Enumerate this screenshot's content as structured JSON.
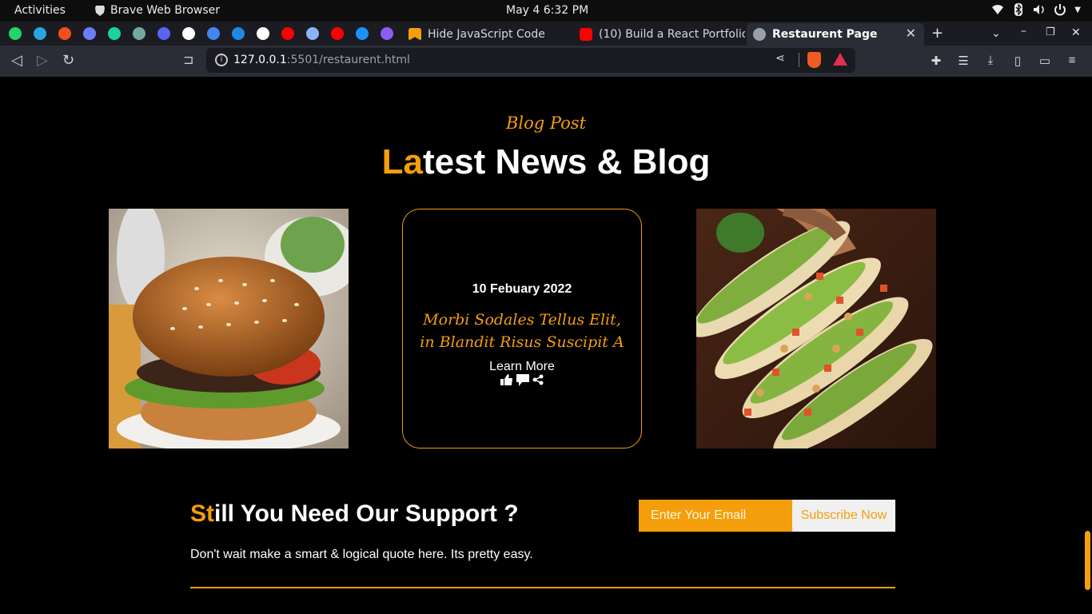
{
  "system": {
    "activities": "Activities",
    "app_name": "Brave Web Browser",
    "clock": "May 4   6:32 PM"
  },
  "tabs": [
    {
      "label": "Hide JavaScript Code",
      "favicon_color": "#f59e0b"
    },
    {
      "label": "(10) Build a React Portfolio",
      "favicon_color": "#ff0000"
    },
    {
      "label": "Restaurent Page",
      "favicon_color": "#9aa0a6"
    }
  ],
  "pinned_tabs": [
    {
      "icon": "whatsapp-icon",
      "color": "#25d366"
    },
    {
      "icon": "telegram-icon",
      "color": "#2aa3df"
    },
    {
      "icon": "figma-icon",
      "color": "#f24e1e"
    },
    {
      "icon": "app-icon",
      "color": "#6c7cff"
    },
    {
      "icon": "app-icon",
      "color": "#1cd1a1"
    },
    {
      "icon": "openai-icon",
      "color": "#74aa9c"
    },
    {
      "icon": "app-icon",
      "color": "#5865f2"
    },
    {
      "icon": "app-icon",
      "color": "#ffffff"
    },
    {
      "icon": "docs-icon",
      "color": "#4285f4"
    },
    {
      "icon": "play-icon",
      "color": "#1e88e5"
    },
    {
      "icon": "app-icon",
      "color": "#ffffff"
    },
    {
      "icon": "youtube-icon",
      "color": "#ff0000"
    },
    {
      "icon": "send-icon",
      "color": "#8ab4f8"
    },
    {
      "icon": "youtube-icon",
      "color": "#ff0000"
    },
    {
      "icon": "app-icon",
      "color": "#1e90ff"
    },
    {
      "icon": "app-icon",
      "color": "#8b5cf6"
    }
  ],
  "address_bar": {
    "host": "127.0.0.1",
    "path": ":5501/restaurent.html"
  },
  "blog": {
    "eyebrow": "Blog Post",
    "title_accent": "La",
    "title_rest": "test News & Blog",
    "card": {
      "date": "10 Febuary 2022",
      "title": "Morbi Sodales Tellus Elit, in Blandit Risus Suscipit A",
      "link": "Learn More"
    }
  },
  "support": {
    "title_accent": "St",
    "title_rest": "ill You Need Our Support ?",
    "subtitle": "Don't wait make a smart & logical quote here. Its pretty easy.",
    "email_placeholder": "Enter Your Email",
    "button": "Subscribe Now"
  },
  "colors": {
    "accent": "#f59e0b",
    "background": "#000000"
  }
}
